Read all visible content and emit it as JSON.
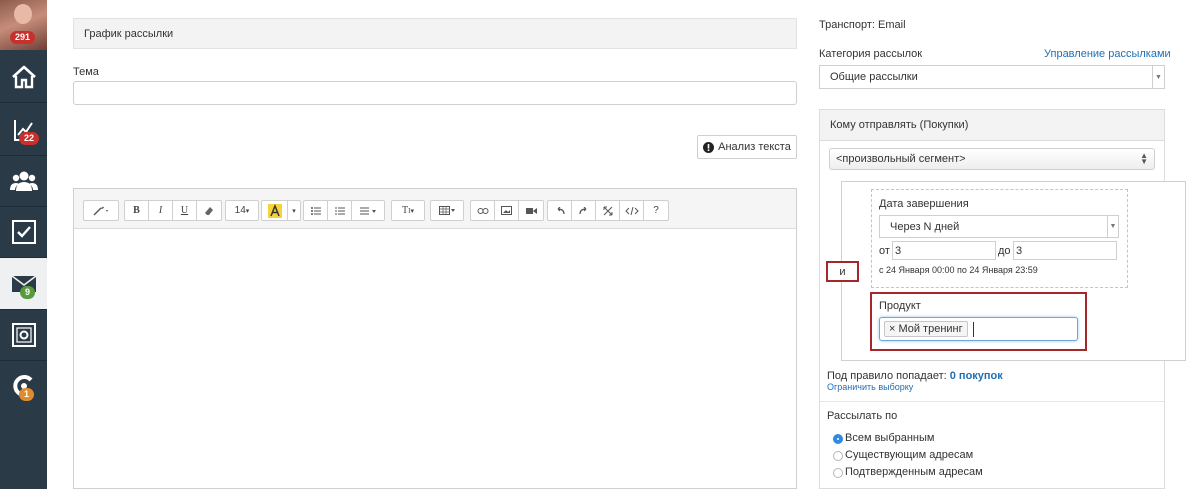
{
  "sidebar": {
    "avatar_badge": "291",
    "items": [
      {
        "icon": "home-icon",
        "badge": ""
      },
      {
        "icon": "chart-growth-icon",
        "badge": "22"
      },
      {
        "icon": "users-icon",
        "badge": ""
      },
      {
        "icon": "checkbox-icon",
        "badge": ""
      },
      {
        "icon": "mail-icon",
        "badge": "9"
      },
      {
        "icon": "settings-screen-icon",
        "badge": ""
      },
      {
        "icon": "logo-icon",
        "badge": "1"
      }
    ]
  },
  "main": {
    "panel_title": "График рассылки",
    "subject_label": "Тема",
    "subject_value": "",
    "analyze_button": "Анализ текста",
    "toolbar": {
      "font_size": "14",
      "buttons": [
        "B",
        "I",
        "U",
        "T",
        "?"
      ]
    }
  },
  "right": {
    "transport": "Транспорт: Email",
    "category_label": "Категория рассылок",
    "manage_link": "Управление рассылками",
    "category_value": "Общие рассылки",
    "recipients_title": "Кому отправлять (Покупки)",
    "segment_value": "<произвольный сегмент>",
    "and_label": "и",
    "end_date_label": "Дата завершения",
    "end_date_mode": "Через N дней",
    "from_label": "от",
    "from_value": "3",
    "to_label": "до",
    "to_value": "3",
    "range_hint": "с 24 Января 00:00 по 24 Января 23:59",
    "product_label": "Продукт",
    "product_tag": "Мой тренинг",
    "product_tag_remove": "×",
    "rule_count_prefix": "Под правило попадает:",
    "rule_count_value": "0 покупок",
    "limit_link": "Ограничить выборку",
    "send_by_label": "Рассылать по",
    "send_by_options": [
      {
        "label": "Всем выбранным",
        "checked": true
      },
      {
        "label": "Существующим адресам",
        "checked": false
      },
      {
        "label": "Подтвержденным адресам",
        "checked": false
      }
    ]
  },
  "colors": {
    "sidebar": "#2a3a47",
    "link": "#1e6fb5",
    "highlight": "#a5262b",
    "badge_red": "#c9302c",
    "badge_green": "#5a9a3e",
    "badge_orange": "#e08a2c"
  }
}
